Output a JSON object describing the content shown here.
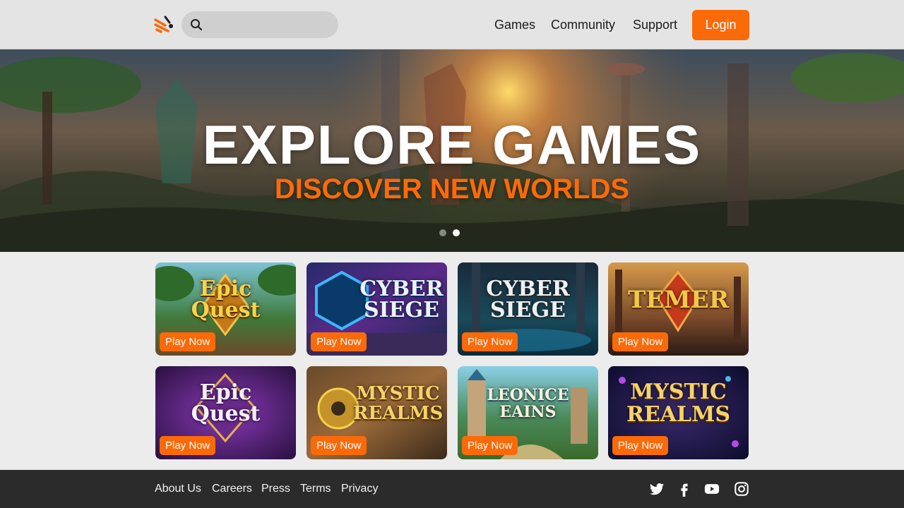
{
  "header": {
    "search_placeholder": "",
    "nav": [
      "Games",
      "Community",
      "Support"
    ],
    "login_label": "Login"
  },
  "hero": {
    "title": "EXPLORE GAMES",
    "subtitle": "DISCOVER NEW WORLDS",
    "slides_total": 2,
    "active_slide": 2
  },
  "cards": [
    {
      "title": "Epic Quest",
      "button": "Play Now"
    },
    {
      "title": "CYBER SIEGE",
      "button": "Play Now"
    },
    {
      "title": "CYBER SIEGE",
      "button": "Play Now"
    },
    {
      "title": "TEMER",
      "button": "Play Now"
    },
    {
      "title": "Epic Quest",
      "button": "Play Now"
    },
    {
      "title": "MYSTIC REALMS",
      "button": "Play Now"
    },
    {
      "title": "LEONICE EAINS",
      "button": "Play Now"
    },
    {
      "title": "MYSTIC REALMS",
      "button": "Play Now"
    }
  ],
  "footer": {
    "links": [
      "About Us",
      "Careers",
      "Press",
      "Terms",
      "Privacy"
    ],
    "social_icons": [
      "twitter-icon",
      "facebook-icon",
      "youtube-icon",
      "instagram-icon"
    ]
  },
  "colors": {
    "accent": "#fb6a09",
    "header_bg": "#e4e4e4",
    "footer_bg": "#2b2b2b",
    "page_bg": "#ececec"
  }
}
